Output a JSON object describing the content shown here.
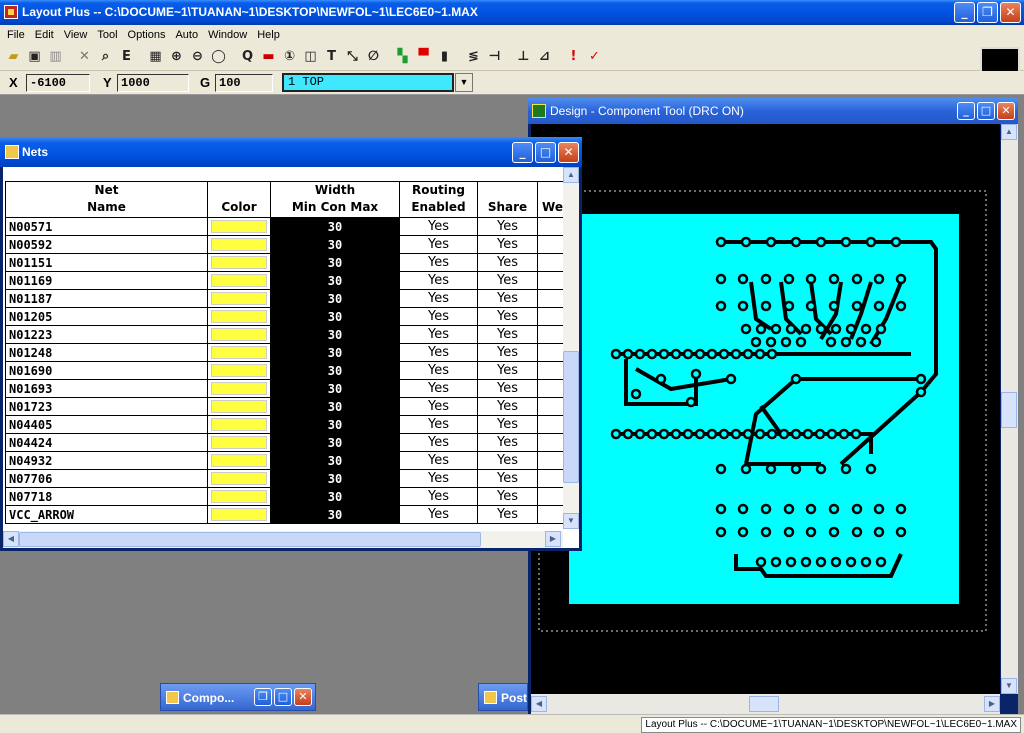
{
  "app": {
    "title": "Layout Plus -- C:\\DOCUME~1\\TUANAN~1\\DESKTOP\\NEWFOL~1\\LEC6E0~1.MAX",
    "status": "Layout Plus -- C:\\DOCUME~1\\TUANAN~1\\DESKTOP\\NEWFOL~1\\LEC6E0~1.MAX"
  },
  "menu": [
    "File",
    "Edit",
    "View",
    "Tool",
    "Options",
    "Auto",
    "Window",
    "Help"
  ],
  "toolbar_icons": [
    "open-icon",
    "save-icon",
    "library-icon",
    "delete-icon",
    "find-icon",
    "edit-icon",
    "spreadsheet-icon",
    "zoom-in-icon",
    "zoom-out-icon",
    "zoom-all-icon",
    "query-icon",
    "component-icon",
    "pin-icon",
    "obstacle-icon",
    "text-icon",
    "connection-icon",
    "error-icon",
    "color-icon",
    "drc-icon",
    "reconnect-icon",
    "shove-icon",
    "route-icon",
    "autoroute-icon",
    "refresh-icon",
    "online-drc-icon",
    "check-icon"
  ],
  "coords": {
    "x_label": "X",
    "x_value": "-6100",
    "y_label": "Y",
    "y_value": "1000",
    "g_label": "G",
    "g_value": "100",
    "layer": "1 TOP"
  },
  "nets_window": {
    "title": "Nets",
    "headers": {
      "name": "Net\nName",
      "color": "Color",
      "width": "Width\nMin Con Max",
      "routing": "Routing\nEnabled",
      "share": "Share",
      "weight": "We"
    },
    "rows": [
      {
        "name": "N00571",
        "width": "30",
        "routing": "Yes",
        "share": "Yes"
      },
      {
        "name": "N00592",
        "width": "30",
        "routing": "Yes",
        "share": "Yes"
      },
      {
        "name": "N01151",
        "width": "30",
        "routing": "Yes",
        "share": "Yes"
      },
      {
        "name": "N01169",
        "width": "30",
        "routing": "Yes",
        "share": "Yes"
      },
      {
        "name": "N01187",
        "width": "30",
        "routing": "Yes",
        "share": "Yes"
      },
      {
        "name": "N01205",
        "width": "30",
        "routing": "Yes",
        "share": "Yes"
      },
      {
        "name": "N01223",
        "width": "30",
        "routing": "Yes",
        "share": "Yes"
      },
      {
        "name": "N01248",
        "width": "30",
        "routing": "Yes",
        "share": "Yes"
      },
      {
        "name": "N01690",
        "width": "30",
        "routing": "Yes",
        "share": "Yes"
      },
      {
        "name": "N01693",
        "width": "30",
        "routing": "Yes",
        "share": "Yes"
      },
      {
        "name": "N01723",
        "width": "30",
        "routing": "Yes",
        "share": "Yes"
      },
      {
        "name": "N04405",
        "width": "30",
        "routing": "Yes",
        "share": "Yes"
      },
      {
        "name": "N04424",
        "width": "30",
        "routing": "Yes",
        "share": "Yes"
      },
      {
        "name": "N04932",
        "width": "30",
        "routing": "Yes",
        "share": "Yes"
      },
      {
        "name": "N07706",
        "width": "30",
        "routing": "Yes",
        "share": "Yes"
      },
      {
        "name": "N07718",
        "width": "30",
        "routing": "Yes",
        "share": "Yes"
      },
      {
        "name": "VCC_ARROW",
        "width": "30",
        "routing": "Yes",
        "share": "Yes"
      }
    ],
    "net_color": "#ffff40"
  },
  "design_window": {
    "title": "Design - Component Tool (DRC ON)",
    "board_color": "#00ffff"
  },
  "minimized": {
    "compo": "Compo...",
    "post": "Post"
  }
}
